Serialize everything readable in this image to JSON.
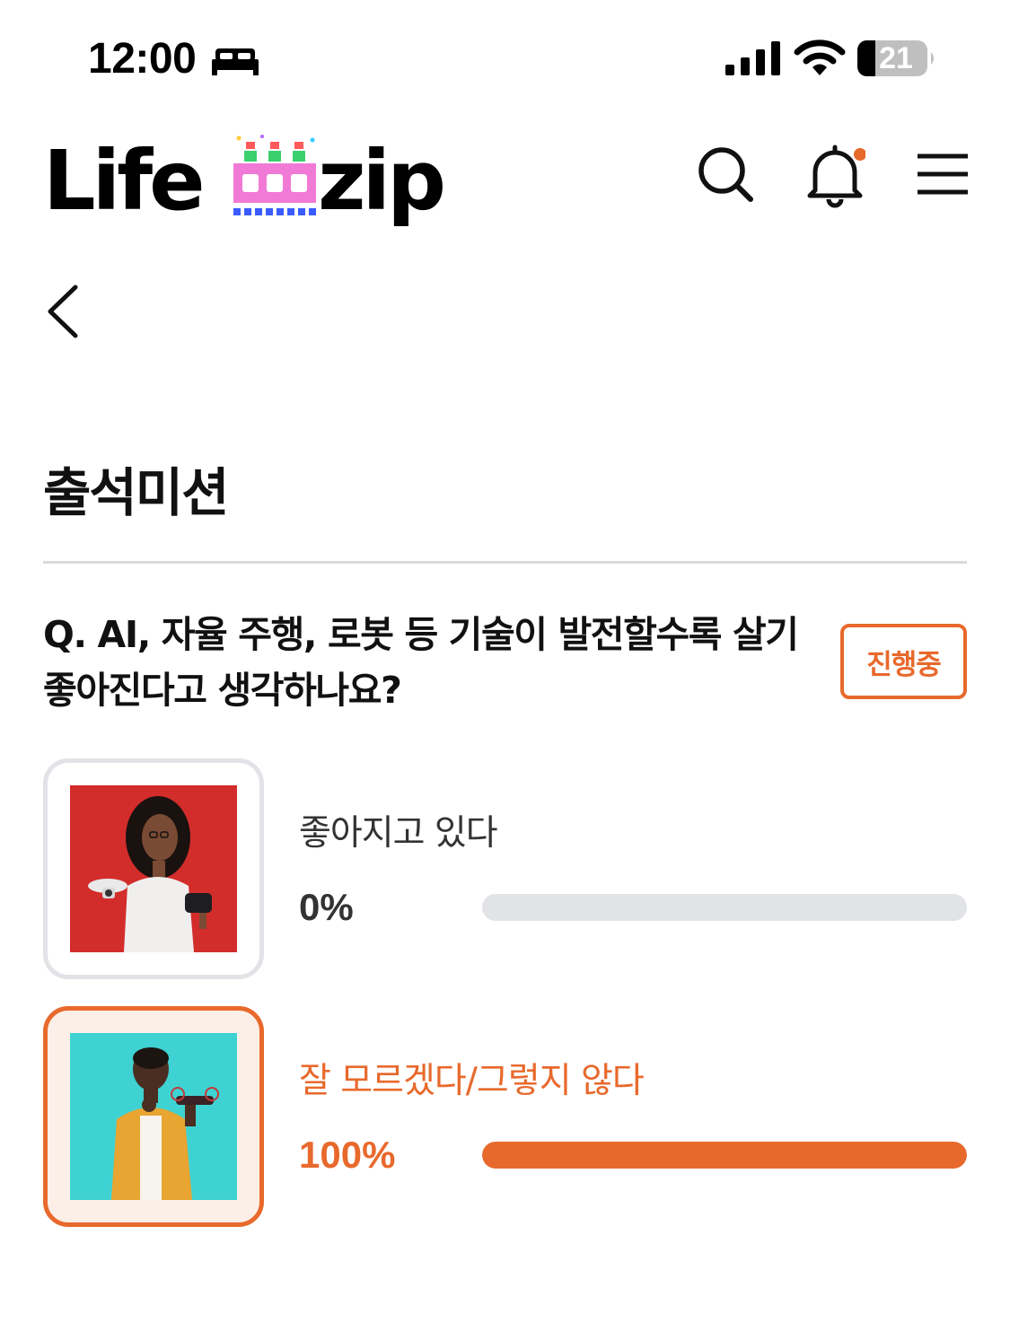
{
  "status_bar": {
    "time": "12:00",
    "battery": "21",
    "icons": [
      "bed-icon",
      "cellular-signal-icon",
      "wifi-icon",
      "battery-icon"
    ]
  },
  "header": {
    "logo_left": "Life",
    "logo_right": "zip",
    "icons": [
      "search-icon",
      "bell-icon",
      "menu-icon"
    ],
    "notification_dot": true
  },
  "page": {
    "title": "출석미션",
    "question": "Q. AI, 자율 주행, 로봇 등 기술이 발전할수록 살기 좋아진다고 생각하나요?",
    "status_badge": "진행중"
  },
  "options": [
    {
      "label": "좋아지고 있다",
      "percent_text": "0%",
      "percent": 0,
      "selected": false
    },
    {
      "label": "잘 모르겠다/그렇지 않다",
      "percent_text": "100%",
      "percent": 100,
      "selected": true
    }
  ],
  "colors": {
    "accent": "#e8692c",
    "track": "#e1e3e7",
    "text": "#111111"
  }
}
